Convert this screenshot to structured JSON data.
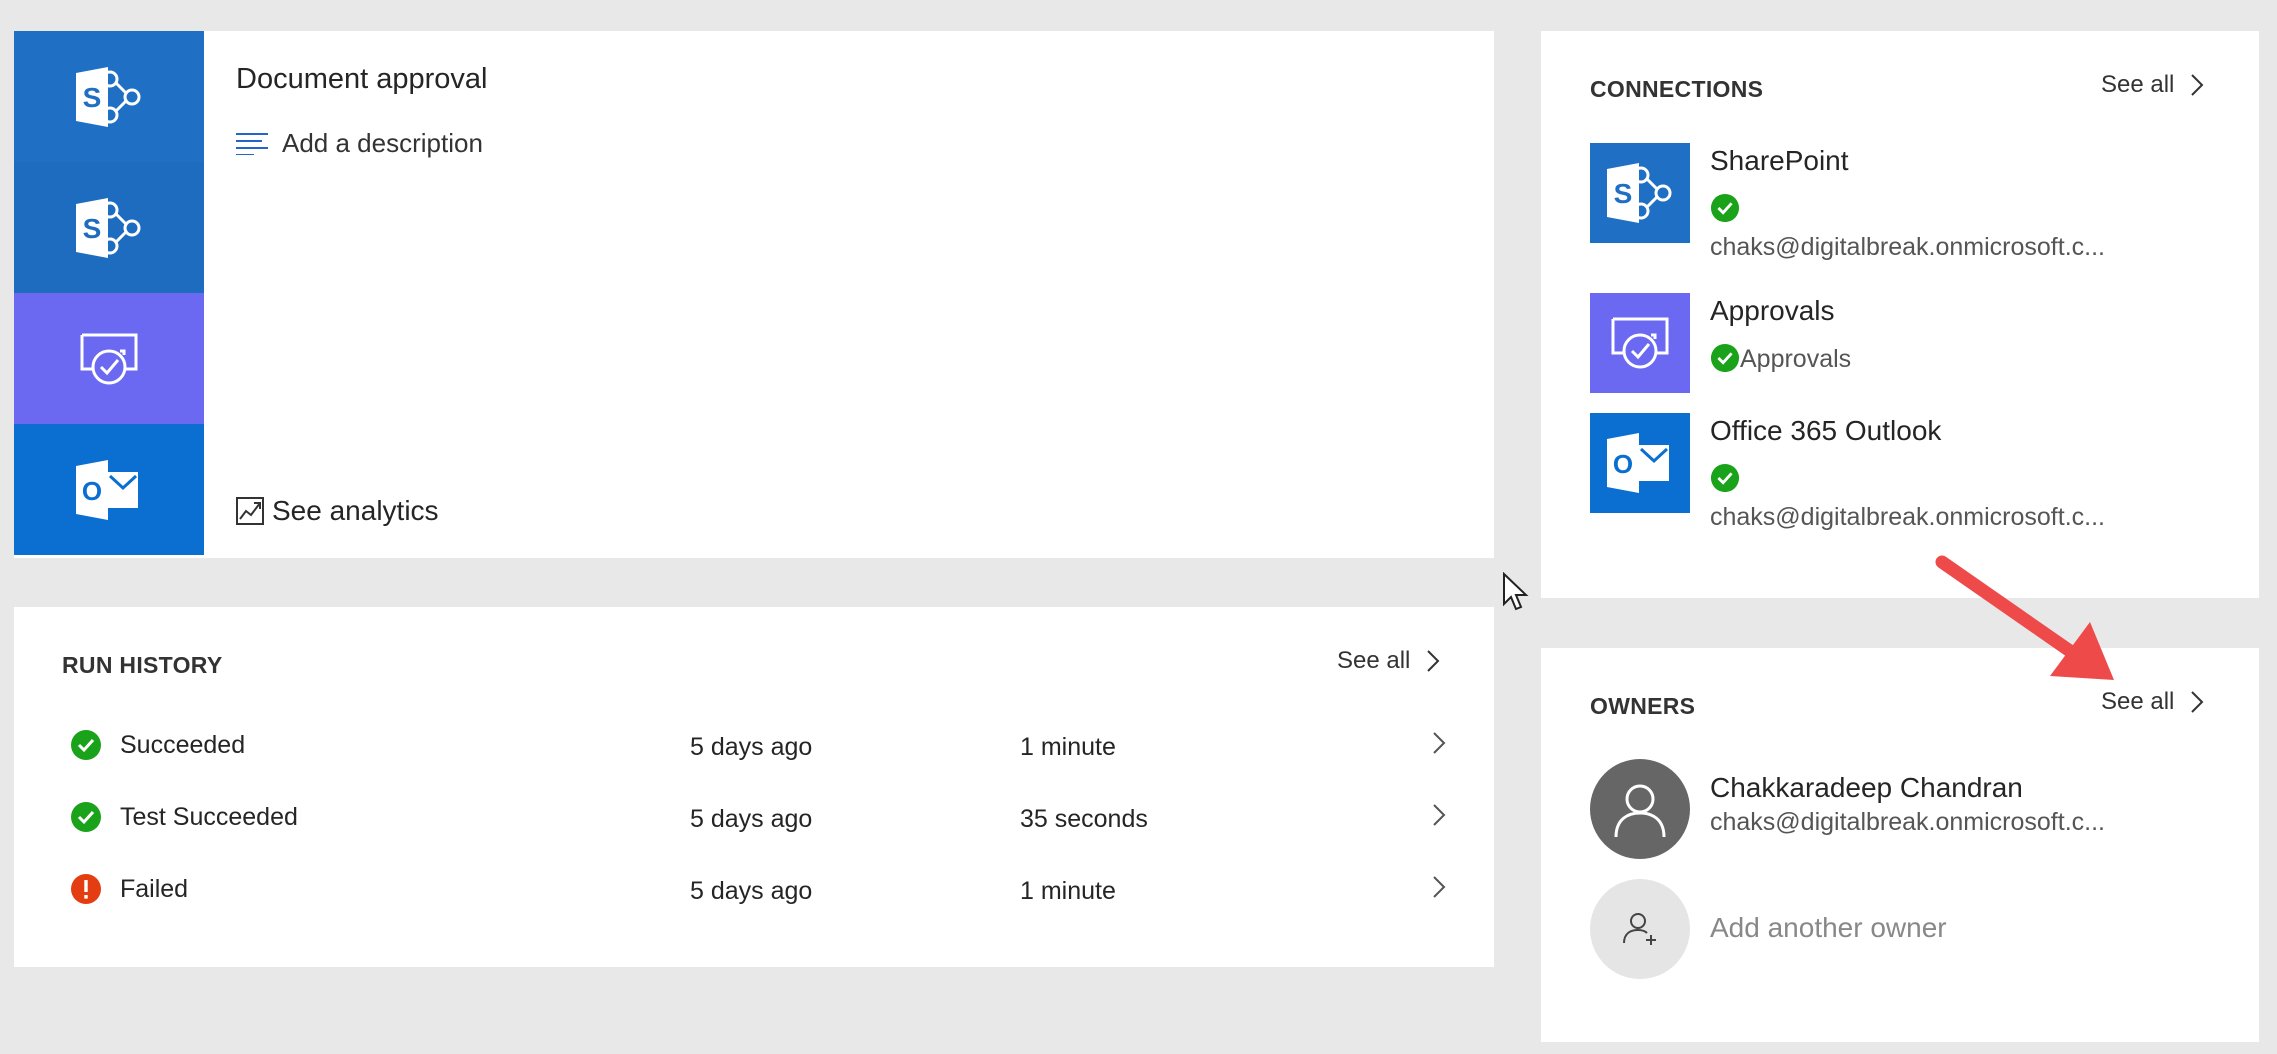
{
  "flow": {
    "title": "Document approval",
    "add_description": "Add a description",
    "see_analytics": "See analytics",
    "strip_icons": [
      "sharepoint-icon",
      "sharepoint-icon",
      "approvals-icon",
      "outlook-icon"
    ]
  },
  "run_history": {
    "title": "RUN HISTORY",
    "see_all": "See all",
    "runs": [
      {
        "status": "Succeeded",
        "when": "5 days ago",
        "duration": "1 minute",
        "state": "success"
      },
      {
        "status": "Test Succeeded",
        "when": "5 days ago",
        "duration": "35 seconds",
        "state": "success"
      },
      {
        "status": "Failed",
        "when": "5 days ago",
        "duration": "1 minute",
        "state": "failed"
      }
    ]
  },
  "connections": {
    "title": "CONNECTIONS",
    "see_all": "See all",
    "items": [
      {
        "name": "SharePoint",
        "account": "chaks@digitalbreak.onmicrosoft.c...",
        "icon": "sharepoint-icon"
      },
      {
        "name": "Approvals",
        "account": "Approvals",
        "icon": "approvals-icon"
      },
      {
        "name": "Office 365 Outlook",
        "account": "chaks@digitalbreak.onmicrosoft.c...",
        "icon": "outlook-icon"
      }
    ]
  },
  "owners": {
    "title": "OWNERS",
    "see_all": "See all",
    "items": [
      {
        "name": "Chakkaradeep Chandran",
        "email": "chaks@digitalbreak.onmicrosoft.c..."
      }
    ],
    "add_owner": "Add another owner"
  },
  "colors": {
    "sharepoint": "#1f6fc5",
    "sharepoint_alt": "#1e6cbf",
    "approvals": "#6b69f1",
    "outlook": "#0a6fd1",
    "success": "#1aa31a",
    "failed": "#e53d12",
    "avatar": "#666666",
    "annotation_arrow": "#ef4a4a"
  }
}
